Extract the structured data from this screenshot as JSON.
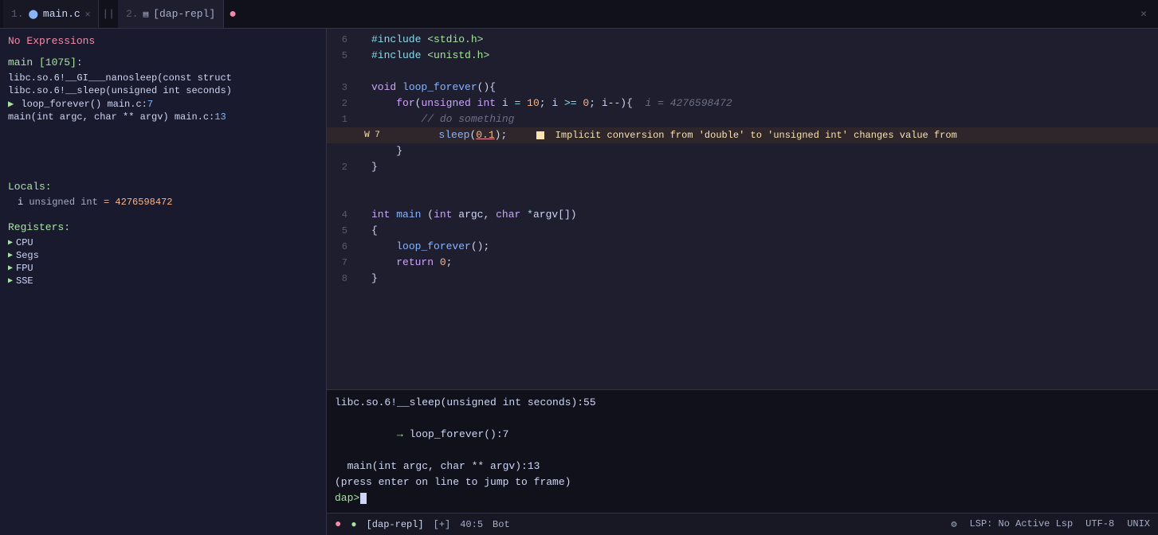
{
  "tabs": [
    {
      "index": "1.",
      "icon": "c-icon",
      "label": "main.c",
      "closable": true,
      "active": true
    },
    {
      "index": "2.",
      "icon": "file-icon",
      "label": "[dap-repl]",
      "closable": false,
      "active": false
    }
  ],
  "left_panel": {
    "expressions_label": "No Expressions",
    "call_stack_header": "main [1075]:",
    "call_stack_items": [
      {
        "text": "libc.so.6!__GI___nanosleep(const struct",
        "arrow": false
      },
      {
        "text": "libc.so.6!__sleep(unsigned int seconds)",
        "arrow": false
      },
      {
        "text": "loop_forever() main.c:7",
        "arrow": true
      },
      {
        "text": "main(int argc, char ** argv) main.c:13",
        "arrow": false
      }
    ],
    "locals_header": "Locals:",
    "locals_items": [
      {
        "name": "i",
        "type": "unsigned int",
        "value": "= 4276598472"
      }
    ],
    "registers_header": "Registers:",
    "registers_items": [
      {
        "label": "CPU"
      },
      {
        "label": "Segs"
      },
      {
        "label": "FPU"
      },
      {
        "label": "SSE"
      }
    ]
  },
  "code": {
    "lines": [
      {
        "num": "6",
        "marker": "",
        "content": "#include <stdio.h>",
        "type": "preprocessor"
      },
      {
        "num": "5",
        "marker": "",
        "content": "#include <unistd.h>",
        "type": "preprocessor"
      },
      {
        "num": "",
        "marker": "",
        "content": "",
        "type": "blank"
      },
      {
        "num": "3",
        "marker": "",
        "content": "void loop_forever(){",
        "type": "code"
      },
      {
        "num": "2",
        "marker": "",
        "content": "    for(unsigned int i = 10; i >= 0; i--){  i = 4276598472",
        "type": "code-highlight"
      },
      {
        "num": "1",
        "marker": "",
        "content": "        // do something",
        "type": "comment"
      },
      {
        "num": "7",
        "marker": "W 7",
        "content": "        sleep(0.1);    ■  Implicit conversion from 'double' to 'unsigned int' changes value from",
        "type": "warn"
      },
      {
        "num": "",
        "marker": "",
        "content": "    }",
        "type": "code"
      },
      {
        "num": "2",
        "marker": "",
        "content": "}",
        "type": "code"
      },
      {
        "num": "",
        "marker": "",
        "content": "",
        "type": "blank"
      },
      {
        "num": "",
        "marker": "",
        "content": "",
        "type": "blank"
      },
      {
        "num": "4",
        "marker": "",
        "content": "int main (int argc, char *argv[])",
        "type": "code"
      },
      {
        "num": "5",
        "marker": "",
        "content": "{",
        "type": "code"
      },
      {
        "num": "6",
        "marker": "",
        "content": "    loop_forever();",
        "type": "code"
      },
      {
        "num": "7",
        "marker": "",
        "content": "    return 0;",
        "type": "code"
      },
      {
        "num": "8",
        "marker": "",
        "content": "}",
        "type": "code"
      }
    ]
  },
  "terminal": {
    "lines": [
      {
        "text": "libc.so.6!__sleep(unsigned int seconds):55",
        "arrow": false
      },
      {
        "text": "loop_forever():7",
        "arrow": true
      },
      {
        "text": "main(int argc, char ** argv):13",
        "arrow": false
      },
      {
        "text": "(press enter on line to jump to frame)",
        "arrow": false
      }
    ],
    "prompt": "dap>"
  },
  "status_bar": {
    "dot_color": "#f38ba8",
    "tab_label": "[dap-repl]",
    "buffer_flag": "[+]",
    "position": "40:5",
    "scroll": "Bot",
    "lsp_label": "LSP: No Active Lsp",
    "encoding": "UTF-8",
    "line_ending": "UNIX"
  }
}
